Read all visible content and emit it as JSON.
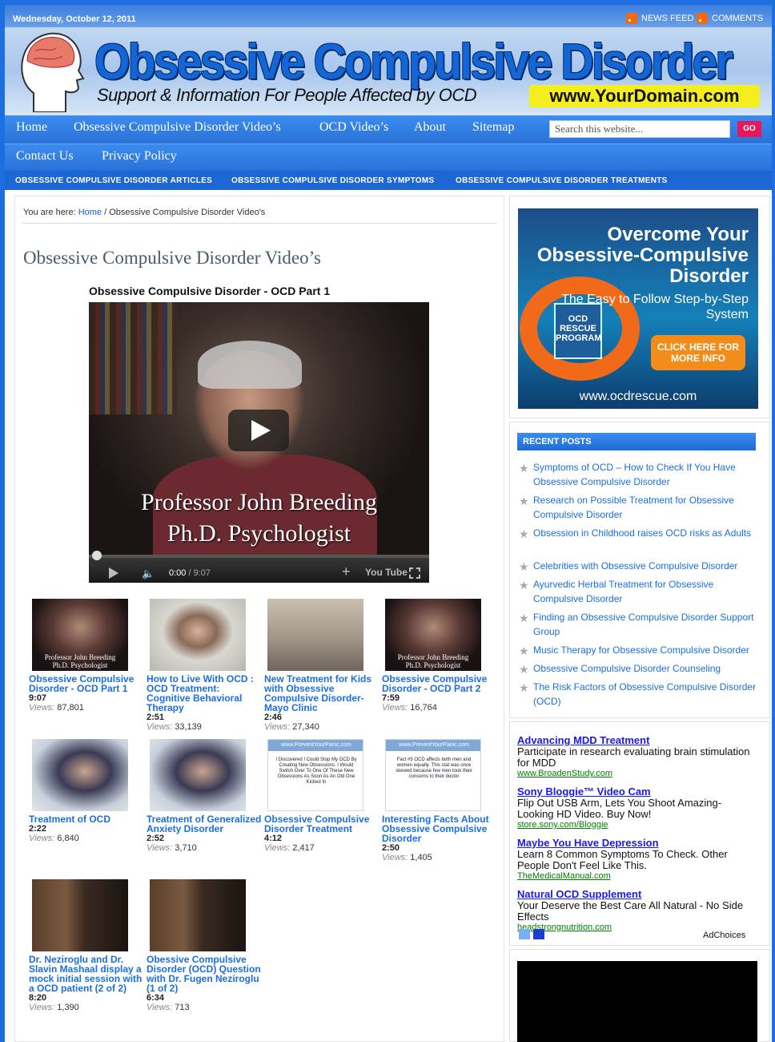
{
  "header": {
    "date": "Wednesday, October 12, 2011",
    "feeds": [
      "NEWS FEED",
      "COMMENTS"
    ],
    "title": "Obsessive Compulsive Disorder",
    "tagline": "Support & Information For People Affected by OCD",
    "domain": "www.YourDomain.com"
  },
  "nav": {
    "primary": [
      "Home",
      "Obsessive Compulsive Disorder Video’s",
      "OCD Video’s",
      "About",
      "Sitemap"
    ],
    "secondary": [
      "Contact Us",
      "Privacy Policy"
    ],
    "search_placeholder": "Search this website...",
    "search_button": "GO",
    "subnav": [
      "OBSESSIVE COMPULSIVE DISORDER ARTICLES",
      "OBSESSIVE COMPULSIVE DISORDER SYMPTOMS",
      "OBSESSIVE COMPULSIVE DISORDER TREATMENTS"
    ]
  },
  "breadcrumb": {
    "prefix": "You are here: ",
    "home": "Home",
    "sep": " / ",
    "current": "Obsessive Compulsive Disorder Video's"
  },
  "page": {
    "title": "Obsessive Compulsive Disorder Video’s",
    "video_title": "Obsessive Compulsive Disorder - OCD Part 1",
    "caption_line1": "Professor John Breeding",
    "caption_line2": "Ph.D. Psychologist",
    "time_current": "0:00",
    "time_total": " / 9:07",
    "yt_label": "You Tube"
  },
  "videos": [
    {
      "title": "Obsessive Compulsive Disorder - OCD Part 1",
      "duration": "9:07",
      "views": "87,801"
    },
    {
      "title": "How to Live With OCD : OCD Treatment: Cognitive Behavioral Therapy",
      "duration": "2:51",
      "views": "33,139"
    },
    {
      "title": "New Treatment for Kids with Obsessive Compulsive Disorder-Mayo Clinic",
      "duration": "2:46",
      "views": "27,340"
    },
    {
      "title": "Obsessive Compulsive Disorder - OCD Part 2",
      "duration": "7:59",
      "views": "16,764"
    },
    {
      "title": "Treatment of OCD",
      "duration": "2:22",
      "views": "6,840"
    },
    {
      "title": "Treatment of Generalized Anxiety Disorder",
      "duration": "2:52",
      "views": "3,710"
    },
    {
      "title": "Obsessive Compulsive Disorder Treatment",
      "duration": "4:12",
      "views": "2,417"
    },
    {
      "title": "Interesting Facts About Obsessive Compulsive Disorder",
      "duration": "2:50",
      "views": "1,405"
    },
    {
      "title": "Dr. Neziroglu and Dr. Slavin Mashaal display a mock initial session with a OCD patient (2 of 2)",
      "duration": "8:20",
      "views": "1,390"
    },
    {
      "title": "Obessive Compulsive Disorder (OCD) Question with Dr. Fugen Neziroglu (1 of 2)",
      "duration": "6:34",
      "views": "713"
    }
  ],
  "views_label": "Views:",
  "thumb_overlays": {
    "prevent_banner": "www.PreventYourPanic.com",
    "prevent_text": "I Discovered I Could Stop My OCD By Creating New Obsessions. I Would Switch Over To One Of These New Obsessions As Soon As An Old One Kicked In",
    "facts_banner": "www.PreventYourPanic.com",
    "facts_text": "Fact #5 OCD affects both men and women equally. This stat was once skewed because few men took their concerns to their doctor"
  },
  "sidebar": {
    "banner": {
      "headline": "Overcome Your Obsessive-Compulsive Disorder",
      "sub": "The Easy to Follow Step-by-Step System",
      "product": "OCD RESCUE PROGRAM",
      "cta": "CLICK HERE FOR MORE INFO",
      "url": "www.ocdrescue.com"
    },
    "recent_heading": "RECENT POSTS",
    "recent_posts": [
      "Symptoms of OCD – How to Check If You Have Obsessive Compulsive Disorder",
      "Research on Possible Treatment for Obsessive Compulsive Disorder",
      "Obsession in Childhood raises OCD risks as Adults",
      "Celebrities with Obsessive Compulsive Disorder",
      "Ayurvedic Herbal Treatment for Obsessive Compulsive Disorder",
      "Finding an Obsessive Compulsive Disorder Support Group",
      "Music Therapy for Obsessive Compulsive Disorder",
      "Obsessive Compulsive Disorder Counseling",
      "The Risk Factors of Obsessive Compulsive Disorder (OCD)"
    ],
    "ads": [
      {
        "title": "Advancing MDD Treatment",
        "desc": "Participate in research evaluating brain stimulation for MDD",
        "url": "www.BroadenStudy.com"
      },
      {
        "title": "Sony Bloggie™ Video Cam",
        "desc": "Flip Out USB Arm, Lets You Shoot Amazing-Looking HD Video. Buy Now!",
        "url": "store.sony.com/Bloggie"
      },
      {
        "title": "Maybe You Have Depression",
        "desc": "Learn 8 Common Symptoms To Check. Other People Don't Feel Like This.",
        "url": "TheMedicalManual.com"
      },
      {
        "title": "Natural OCD Supplement",
        "desc": "Your Deserve the Best Care All Natural - No Side Effects",
        "url": "headstrongnutrition.com"
      }
    ],
    "adchoices": "AdChoices"
  }
}
